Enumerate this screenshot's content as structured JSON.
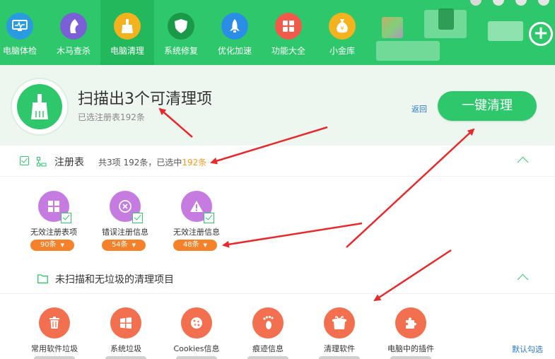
{
  "toolbar": {
    "items": [
      {
        "label": "电脑体检",
        "icon": "monitor-icon",
        "active": false
      },
      {
        "label": "木马查杀",
        "icon": "horse-icon",
        "active": false
      },
      {
        "label": "电脑清理",
        "icon": "broom-icon",
        "active": true
      },
      {
        "label": "系统修复",
        "icon": "shield-icon",
        "active": false
      },
      {
        "label": "优化加速",
        "icon": "rocket-icon",
        "active": false
      },
      {
        "label": "功能大全",
        "icon": "grid-icon",
        "active": false
      },
      {
        "label": "小金库",
        "icon": "money-bag-icon",
        "active": false
      }
    ],
    "plus": "+"
  },
  "summary": {
    "title": "扫描出3个可清理项",
    "subtitle": "已选注册表192条",
    "back": "返回",
    "clean_button": "一键清理"
  },
  "registry": {
    "title": "注册表",
    "info_prefix": "共3项 192条，已选中",
    "info_highlight": "192条",
    "items": [
      {
        "name": "无效注册表项",
        "count": "90条",
        "icon": "grid-icon"
      },
      {
        "name": "错误注册信息",
        "count": "54条",
        "icon": "x-circle-icon"
      },
      {
        "name": "无效注册信息",
        "count": "48条",
        "icon": "warning-icon"
      }
    ]
  },
  "unscanned": {
    "title": "未扫描和无垃圾的清理项目",
    "items": [
      {
        "name": "常用软件垃圾",
        "icon": "trash-icon"
      },
      {
        "name": "系统垃圾",
        "icon": "windows-icon"
      },
      {
        "name": "Cookies信息",
        "icon": "cookie-icon"
      },
      {
        "name": "痕迹信息",
        "icon": "footprint-icon"
      },
      {
        "name": "清理软件",
        "icon": "box-icon"
      },
      {
        "name": "电脑中的插件",
        "icon": "puzzle-icon"
      }
    ],
    "default_link": "默认勾选"
  },
  "colors": {
    "brand_green": "#2ec76b",
    "registry_purple": "#c57be0",
    "unscanned_orange": "#f2704f",
    "count_orange": "#f5822a",
    "arrow_red": "#e8282b"
  }
}
